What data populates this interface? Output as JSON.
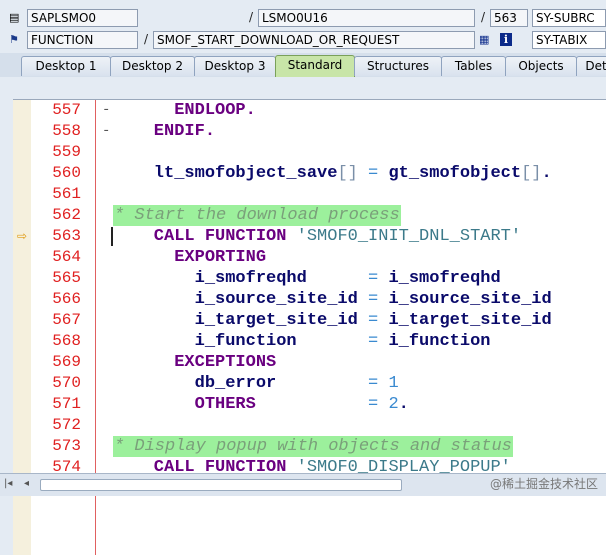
{
  "header": {
    "program": "SAPLSMO0",
    "include": "LSMO0U16",
    "line_no": "563",
    "sy_var_1": "SY-SUBRC",
    "event_type": "FUNCTION",
    "event_name": "SMOF_START_DOWNLOAD_OR_REQUEST",
    "sy_var_2": "SY-TABIX"
  },
  "tabs": [
    "Desktop 1",
    "Desktop 2",
    "Desktop 3",
    "Standard",
    "Structures",
    "Tables",
    "Objects",
    "Det"
  ],
  "active_tab": "Standard",
  "code_lines": [
    {
      "num": "557",
      "dash": "-",
      "parts": [
        {
          "t": "      ENDLOOP.",
          "c": "kw"
        }
      ]
    },
    {
      "num": "558",
      "dash": "-",
      "parts": [
        {
          "t": "    ENDIF.",
          "c": "kw"
        }
      ]
    },
    {
      "num": "559",
      "dash": "",
      "parts": []
    },
    {
      "num": "560",
      "dash": "",
      "parts": [
        {
          "t": "    lt_smofobject_save",
          "c": ""
        },
        {
          "t": "[]",
          "c": "brk"
        },
        {
          "t": " ",
          "c": ""
        },
        {
          "t": "=",
          "c": "op"
        },
        {
          "t": " gt_smofobject",
          "c": ""
        },
        {
          "t": "[]",
          "c": "brk"
        },
        {
          "t": ".",
          "c": ""
        }
      ]
    },
    {
      "num": "561",
      "dash": "",
      "parts": []
    },
    {
      "num": "562",
      "dash": "",
      "comment": "* Start the download process"
    },
    {
      "num": "563",
      "dash": "",
      "current": true,
      "parts": [
        {
          "t": "    CALL FUNCTION ",
          "c": "kw"
        },
        {
          "t": "'SMOF0_INIT_DNL_START'",
          "c": "str"
        }
      ]
    },
    {
      "num": "564",
      "dash": "",
      "parts": [
        {
          "t": "      EXPORTING",
          "c": "kw"
        }
      ]
    },
    {
      "num": "565",
      "dash": "",
      "parts": [
        {
          "t": "        i_smofreqhd      ",
          "c": ""
        },
        {
          "t": "=",
          "c": "op"
        },
        {
          "t": " i_smofreqhd",
          "c": ""
        }
      ]
    },
    {
      "num": "566",
      "dash": "",
      "parts": [
        {
          "t": "        i_source_site_id ",
          "c": ""
        },
        {
          "t": "=",
          "c": "op"
        },
        {
          "t": " i_source_site_id",
          "c": ""
        }
      ]
    },
    {
      "num": "567",
      "dash": "",
      "parts": [
        {
          "t": "        i_target_site_id ",
          "c": ""
        },
        {
          "t": "=",
          "c": "op"
        },
        {
          "t": " i_target_site_id",
          "c": ""
        }
      ]
    },
    {
      "num": "568",
      "dash": "",
      "parts": [
        {
          "t": "        i_function       ",
          "c": ""
        },
        {
          "t": "=",
          "c": "op"
        },
        {
          "t": " i_function",
          "c": ""
        }
      ]
    },
    {
      "num": "569",
      "dash": "",
      "parts": [
        {
          "t": "      EXCEPTIONS",
          "c": "kw"
        }
      ]
    },
    {
      "num": "570",
      "dash": "",
      "parts": [
        {
          "t": "        db_error         ",
          "c": ""
        },
        {
          "t": "=",
          "c": "op"
        },
        {
          "t": " 1",
          "c": "num"
        }
      ]
    },
    {
      "num": "571",
      "dash": "",
      "parts": [
        {
          "t": "        OTHERS",
          "c": "kw"
        },
        {
          "t": "           ",
          "c": ""
        },
        {
          "t": "=",
          "c": "op"
        },
        {
          "t": " 2",
          "c": "num"
        },
        {
          "t": ".",
          "c": ""
        }
      ]
    },
    {
      "num": "572",
      "dash": "",
      "parts": []
    },
    {
      "num": "573",
      "dash": "",
      "comment": "* Display popup with objects and status"
    },
    {
      "num": "574",
      "dash": "",
      "parts": [
        {
          "t": "    CALL FUNCTION ",
          "c": "kw"
        },
        {
          "t": "'SMOF0_DISPLAY_POPUP'",
          "c": "str"
        }
      ]
    }
  ],
  "watermark": "@稀土掘金技术社区",
  "colors": {
    "comment_bg": "#9cf09c",
    "line_number": "#e02020",
    "keyword": "#6a0080",
    "active_tab": "#c8e5a8"
  }
}
